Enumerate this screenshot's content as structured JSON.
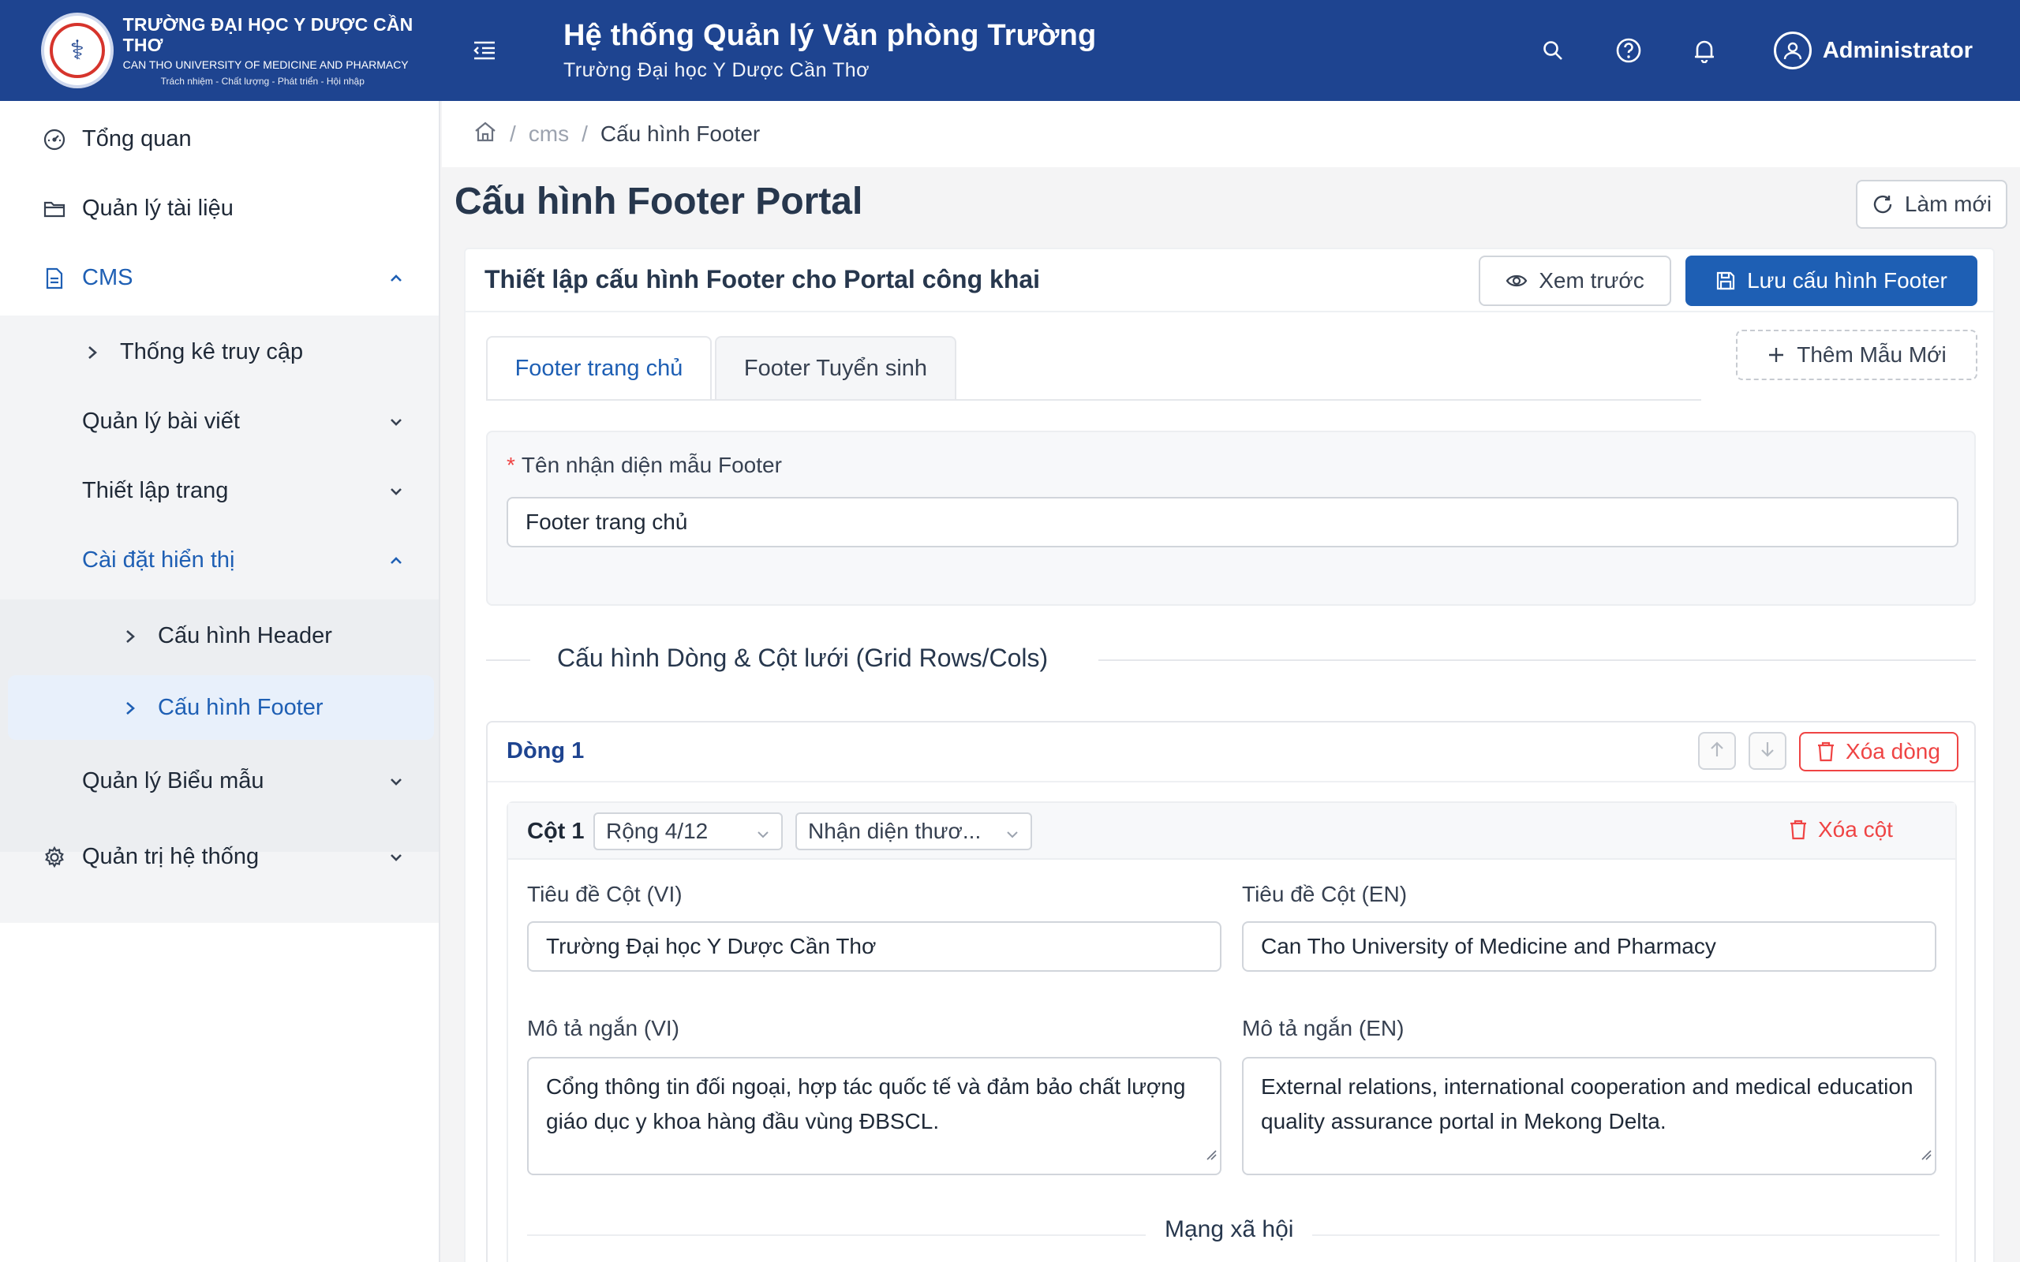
{
  "header": {
    "logo_line1": "TRƯỜNG ĐẠI HỌC Y DƯỢC CẦN THƠ",
    "logo_line2": "CAN THO UNIVERSITY OF MEDICINE AND PHARMACY",
    "logo_line3": "Trách nhiệm - Chất lượng - Phát triển - Hội nhập",
    "title": "Hệ thống Quản lý Văn phòng Trường",
    "subtitle": "Trường Đại học Y Dược Cần Thơ",
    "user_name": "Administrator",
    "icons": [
      "menu-fold-icon",
      "search-icon",
      "help-icon",
      "bell-icon",
      "user-icon"
    ]
  },
  "sidebar": {
    "items": [
      {
        "label": "Tổng quan",
        "icon": "dashboard-icon"
      },
      {
        "label": "Quản lý tài liệu",
        "icon": "folder-icon"
      },
      {
        "label": "CMS",
        "icon": "file-icon"
      },
      {
        "label": "Thống kê truy cập"
      },
      {
        "label": "Quản lý bài viết"
      },
      {
        "label": "Thiết lập trang"
      },
      {
        "label": "Cài đặt hiển thị"
      },
      {
        "label": "Cấu hình Header"
      },
      {
        "label": "Cấu hình Footer"
      },
      {
        "label": "Quản lý Biểu mẫu"
      },
      {
        "label": "Quản trị hệ thống",
        "icon": "settings-icon"
      }
    ]
  },
  "breadcrumb": {
    "items": [
      "cms",
      "Cấu hình Footer"
    ]
  },
  "page": {
    "title": "Cấu hình Footer Portal",
    "refresh_label": "Làm mới",
    "card_title": "Thiết lập cấu hình Footer cho Portal công khai",
    "preview_label": "Xem trước",
    "save_label": "Lưu cấu hình Footer",
    "add_template_label": "Thêm Mẫu Mới",
    "tabs": [
      "Footer trang chủ",
      "Footer Tuyển sinh"
    ],
    "template_name_label": "Tên nhận diện mẫu Footer",
    "template_name_value": "Footer trang chủ",
    "grid_section_title": "Cấu hình Dòng & Cột lưới (Grid Rows/Cols)"
  },
  "row": {
    "label": "Dòng 1",
    "delete_label": "Xóa dòng",
    "column": {
      "label": "Cột 1",
      "width_select": "Rộng 4/12",
      "type_select": "Nhận diện thươ...",
      "delete_label": "Xóa cột",
      "title_vi_label": "Tiêu đề Cột (VI)",
      "title_vi_value": "Trường Đại học Y Dược Cần Thơ",
      "title_en_label": "Tiêu đề Cột (EN)",
      "title_en_value": "Can Tho University of Medicine and Pharmacy",
      "desc_vi_label": "Mô tả ngắn (VI)",
      "desc_vi_value": "Cổng thông tin đối ngoại, hợp tác quốc tế và đảm bảo chất lượng giáo dục y khoa hàng đầu vùng ĐBSCL.",
      "desc_en_label": "Mô tả ngắn (EN)",
      "desc_en_value": "External relations, international cooperation and medical education quality assurance portal in Mekong Delta.",
      "social_title": "Mạng xã hội"
    }
  },
  "colors": {
    "header_bg": "#1e4490",
    "primary": "#1e5fb4",
    "danger": "#ef4444"
  }
}
